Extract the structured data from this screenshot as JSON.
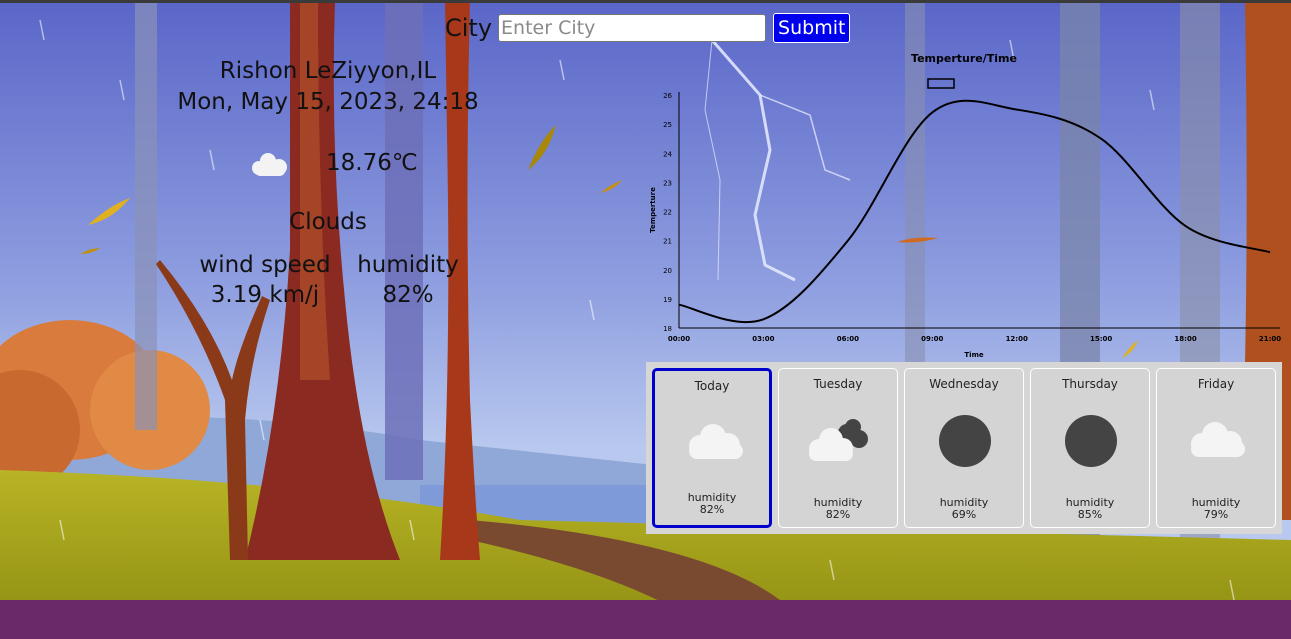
{
  "search": {
    "label": "City",
    "placeholder": "Enter City",
    "value": "",
    "submit_label": "Submit"
  },
  "current": {
    "location": "Rishon LeZiyyon,IL",
    "datetime": "Mon, May 15, 2023, 24:18",
    "icon": "cloud-icon",
    "temperature": "18.76℃",
    "condition": "Clouds",
    "wind_label": "wind speed",
    "wind_value": "3.19 km/j",
    "humidity_label": "humidity",
    "humidity_value": "82%"
  },
  "chart_data": {
    "type": "line",
    "title": "Temperture/Time",
    "xlabel": "Time",
    "ylabel": "Temperture",
    "x_ticks": [
      "00:00",
      "03:00",
      "06:00",
      "09:00",
      "12:00",
      "15:00",
      "18:00",
      "21:00"
    ],
    "y_ticks": [
      18,
      19,
      20,
      21,
      22,
      23,
      24,
      25,
      26
    ],
    "ylim": [
      18,
      26
    ],
    "series": [
      {
        "values": [
          18.8,
          18.3,
          21.0,
          25.4,
          25.5,
          24.5,
          21.5,
          20.6
        ],
        "color": "#000000"
      }
    ],
    "legend": "top-left"
  },
  "forecast": [
    {
      "day": "Today",
      "icon": "cloud-icon",
      "humidity_label": "humidity",
      "humidity": "82%",
      "active": true
    },
    {
      "day": "Tuesday",
      "icon": "broken-clouds-icon",
      "humidity_label": "humidity",
      "humidity": "82%",
      "active": false
    },
    {
      "day": "Wednesday",
      "icon": "dark-circle-icon",
      "humidity_label": "humidity",
      "humidity": "69%",
      "active": false
    },
    {
      "day": "Thursday",
      "icon": "dark-circle-icon",
      "humidity_label": "humidity",
      "humidity": "85%",
      "active": false
    },
    {
      "day": "Friday",
      "icon": "cloud-icon",
      "humidity_label": "humidity",
      "humidity": "79%",
      "active": false
    }
  ],
  "colors": {
    "accent": "#0000ee",
    "active_border": "#0000cc",
    "panel_bg": "#d6d6d6"
  }
}
